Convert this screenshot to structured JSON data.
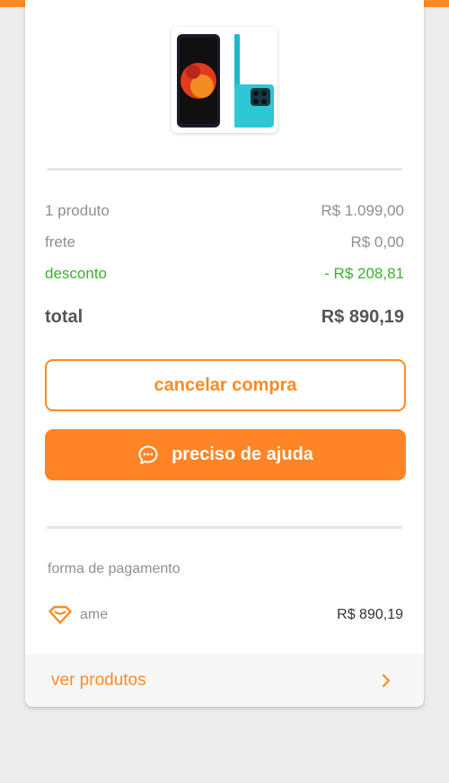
{
  "summary": {
    "items_label": "1 produto",
    "items_value": "R$ 1.099,00",
    "shipping_label": "frete",
    "shipping_value": "R$ 0,00",
    "discount_label": "desconto",
    "discount_value": "- R$ 208,81",
    "total_label": "total",
    "total_value": "R$ 890,19"
  },
  "actions": {
    "cancel_label": "cancelar compra",
    "help_label": "preciso de ajuda"
  },
  "payment": {
    "section_label": "forma de pagamento",
    "method_name": "ame",
    "method_value": "R$ 890,19"
  },
  "footer": {
    "link_label": "ver produtos"
  },
  "colors": {
    "accent": "#ff8a24",
    "discount": "#3bb02e",
    "background": "#ececec"
  },
  "icons": {
    "chat": "chat-bubble-icon",
    "payment": "ame-heart-icon",
    "chevron": "chevron-right-icon"
  }
}
